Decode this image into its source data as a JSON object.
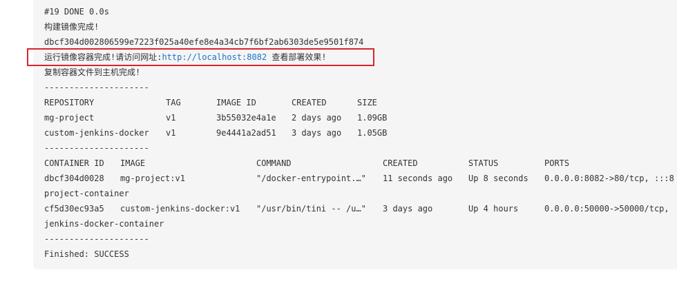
{
  "log": {
    "step_done": "#19 DONE 0.0s",
    "build_complete": "构建镜像完成!",
    "image_hash": "dbcf304d002806599e7223f025a40efe8e4a34cb7f6bf2ab6303de5e9501f874",
    "run_complete_prefix": "运行镜像容器完成!请访问网址:",
    "run_url": "http://localhost:8082",
    "run_complete_suffix": " 查看部署效果!",
    "copy_complete": "复制容器文件到主机完成!",
    "separator": "---------------------",
    "finished": "Finished: SUCCESS"
  },
  "images_table": {
    "headers": [
      "REPOSITORY",
      "TAG",
      "IMAGE ID",
      "CREATED",
      "SIZE"
    ],
    "rows": [
      [
        "mg-project",
        "v1",
        "3b55032e4a1e",
        "2 days ago",
        "1.09GB"
      ],
      [
        "custom-jenkins-docker",
        "v1",
        "9e4441a2ad51",
        "3 days ago",
        "1.05GB"
      ]
    ]
  },
  "containers_table": {
    "headers": [
      "CONTAINER ID",
      "IMAGE",
      "COMMAND",
      "CREATED",
      "STATUS",
      "PORTS"
    ],
    "rows": [
      {
        "cells": [
          "dbcf304d0028",
          "mg-project:v1",
          "\"/docker-entrypoint.…\"",
          "11 seconds ago",
          "Up 8 seconds",
          "0.0.0.0:8082->80/tcp, :::8"
        ],
        "wrap": "project-container"
      },
      {
        "cells": [
          "cf5d30ec93a5",
          "custom-jenkins-docker:v1",
          "\"/usr/bin/tini -- /u…\"",
          "3 days ago",
          "Up 4 hours",
          "0.0.0.0:50000->50000/tcp,"
        ],
        "wrap": "jenkins-docker-container"
      }
    ]
  },
  "colors": {
    "highlight_border": "#d9232d",
    "link": "#1a73c8",
    "console_background": "#f5f5f5"
  }
}
